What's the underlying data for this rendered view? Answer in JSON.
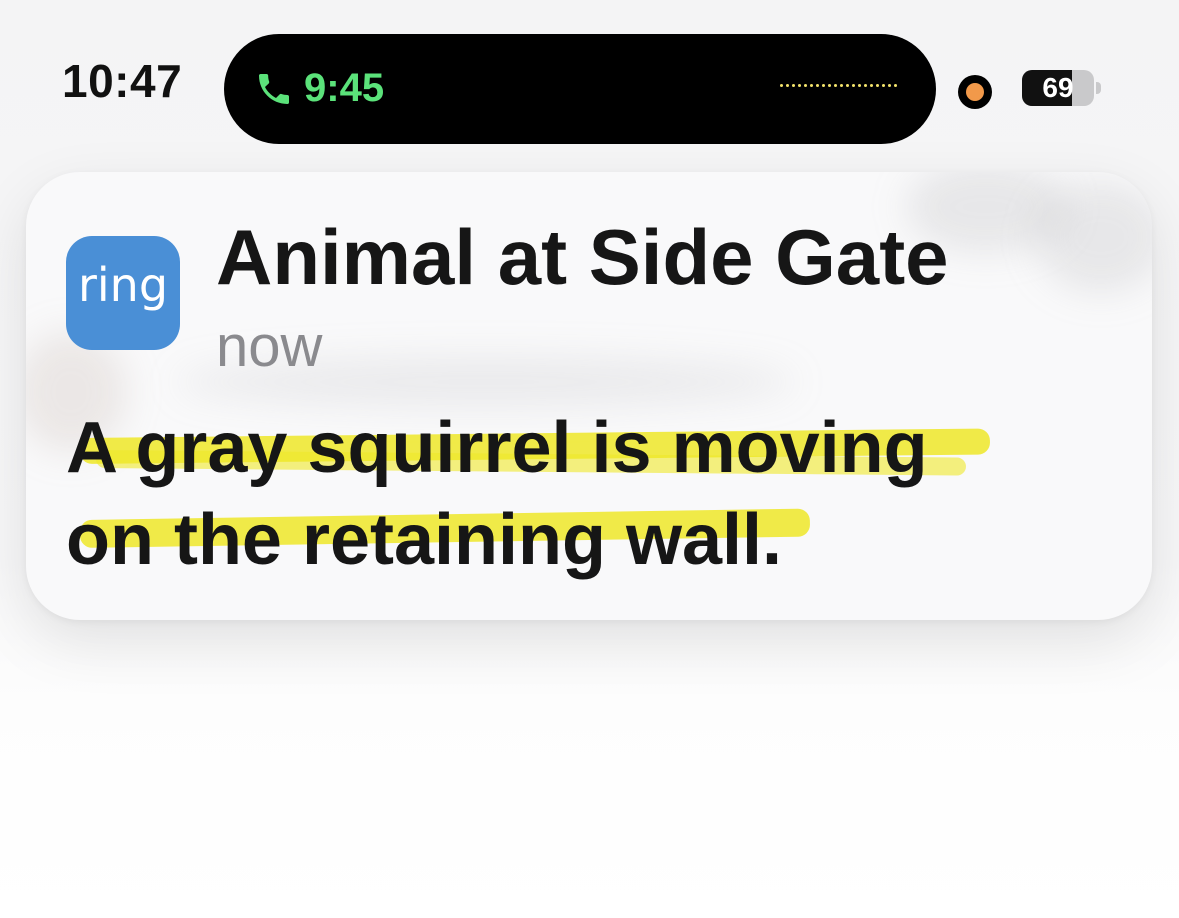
{
  "status_bar": {
    "time": "10:47",
    "call_time": "9:45",
    "battery_level": "69",
    "battery_fraction": 0.69,
    "privacy_indicator_color": "#f2994a",
    "call_accent_color": "#5be27a"
  },
  "notification": {
    "app_icon_text": "ring",
    "app_icon_color": "#4a8fd6",
    "title": "Animal at Side Gate",
    "time": "now",
    "body_line_1": "A gray squirrel is moving",
    "body_line_2": "on the retaining wall.",
    "highlight_color": "#eee828"
  },
  "icons": [
    "phone-icon",
    "privacy-indicator",
    "battery-icon",
    "ring-app-icon"
  ]
}
